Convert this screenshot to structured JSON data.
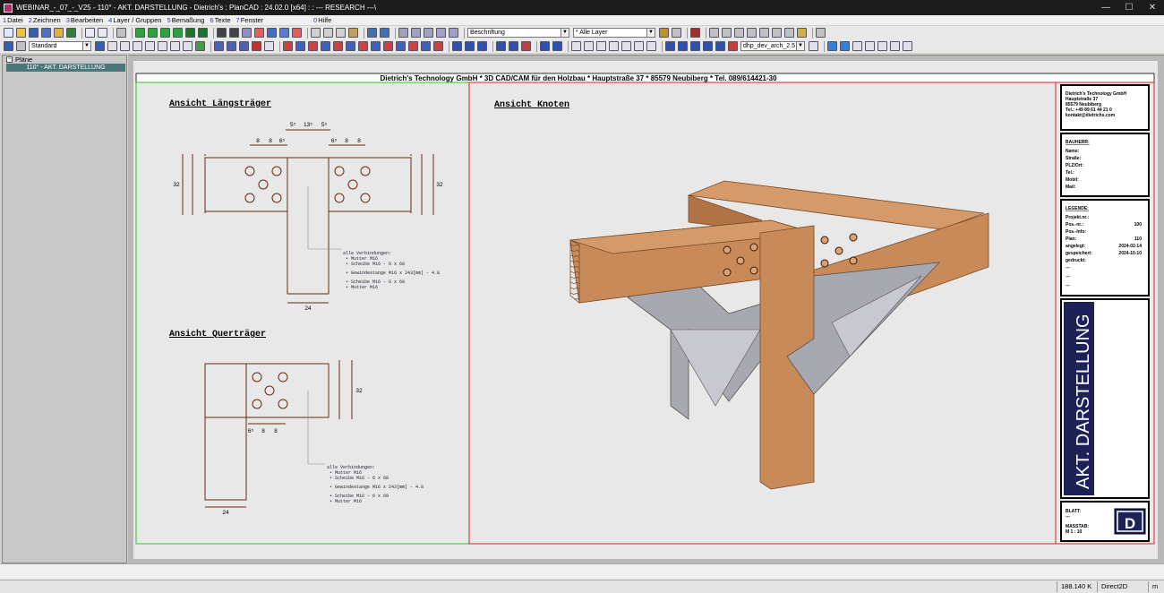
{
  "window": {
    "title": "WEBINAR_-_07_-_V25 - 110° - AKT. DARSTELLUNG - Dietrich's : PlanCAD : 24.02.0 [x64] : : --- RESEARCH ---\\",
    "controls": [
      "—",
      "☐",
      "✕"
    ]
  },
  "menu": [
    {
      "num": "1",
      "label": "Datei"
    },
    {
      "num": "2",
      "label": "Zeichnen"
    },
    {
      "num": "3",
      "label": "Bearbeiten"
    },
    {
      "num": "4",
      "label": "Layer / Gruppen"
    },
    {
      "num": "5",
      "label": "Bemaßung"
    },
    {
      "num": "6",
      "label": "Texte"
    },
    {
      "num": "7",
      "label": "Fenster"
    },
    {
      "num": "0",
      "label": "Hilfe"
    }
  ],
  "toolbar": {
    "text_style": "Beschriftung",
    "layer": "* Alle Layer",
    "line_style": "Standard",
    "layer_name": "dhp_dev_arch_2.5"
  },
  "sidebar": {
    "root": "Pläne",
    "items": [
      "110° - AKT. DARSTELLUNG"
    ]
  },
  "drawing": {
    "header": "Dietrich's Technology GmbH * 3D CAD/CAM für den Holzbau * Hauptstraße 37 * 85579 Neubiberg * Tel. 089/614421-30",
    "view1_title": "Ansicht Längsträger",
    "view2_title": "Ansicht Querträger",
    "view3_title": "Ansicht Knoten",
    "dims_top": [
      "5⁵",
      "13⁵",
      "5⁵"
    ],
    "dims_left": [
      "8",
      "8",
      "6⁵"
    ],
    "dims_right": [
      "6⁵",
      "8",
      "8"
    ],
    "dim_32": "32",
    "dim_24": "24",
    "dims_v": [
      "8",
      "8",
      "8"
    ],
    "dims_q_bottom": [
      "6⁵",
      "8",
      "8"
    ],
    "notes": {
      "title": "alle Verbindungen:",
      "lines": [
        "• Mutter M16",
        "• Scheibe M16 - 6 x 68",
        "• Gewindestange M16 x 243[mm] - 4.8",
        "• Scheibe M16 - 6 x 68",
        "• Mutter M16"
      ]
    }
  },
  "titleblock": {
    "company": [
      "Dietrich's Technology GmbH",
      "Hauptstraße 37",
      "85579 Neubiberg",
      "Tel.: +49 89 61 44 21 0",
      "kontakt@dietrichs.com"
    ],
    "bauherr_title": "BAUHERR:",
    "bauherr_fields": [
      "Name:",
      "Straße:",
      "PLZ/Ort:",
      "Tel.:",
      "Mobil:",
      "Mail:"
    ],
    "legend_title": "LEGENDE:",
    "legend": [
      {
        "k": "Projekt.nr.:",
        "v": ""
      },
      {
        "k": "Pos.-nr.:",
        "v": "100"
      },
      {
        "k": "Pos.-Info:",
        "v": ""
      },
      {
        "k": "Plan:",
        "v": "110"
      },
      {
        "k": "angelegt:",
        "v": "2024-02-14"
      },
      {
        "k": "gespeichert:",
        "v": "2024-10-10"
      },
      {
        "k": "gedruckt:",
        "v": ""
      },
      {
        "k": "---",
        "v": ""
      },
      {
        "k": "---",
        "v": ""
      },
      {
        "k": "---",
        "v": ""
      }
    ],
    "banner": "AKT. DARSTELLUNG",
    "blatt_label": "BLATT:",
    "blatt_value": "---",
    "massstab_label": "MASSTAB:",
    "massstab_value": "M 1 : 10",
    "logo_letter": "D"
  },
  "status": {
    "memory": "188.140 K",
    "renderer": "Direct2D",
    "unit": "m"
  },
  "colors": {
    "wood": "#c98a5a",
    "wood_dark": "#a86a3e",
    "steel": "#a8a8b0",
    "frame_green": "#22cc22",
    "frame_red": "#dd2222",
    "banner_blue": "#1c2258"
  }
}
